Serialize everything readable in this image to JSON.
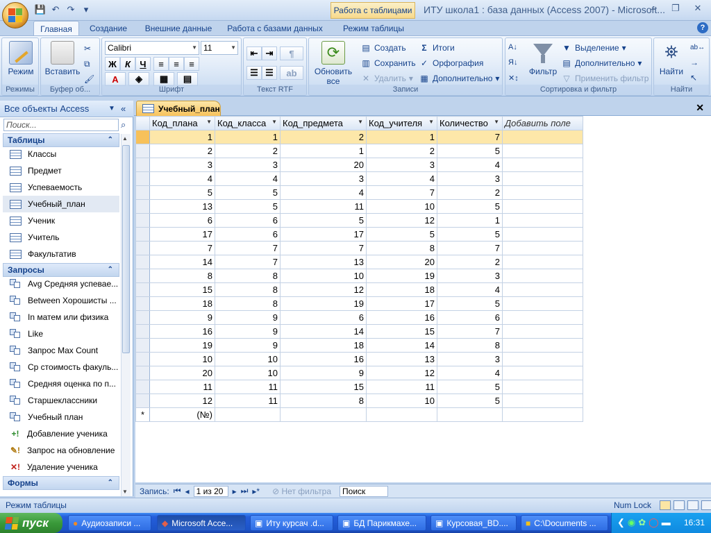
{
  "title_bar": {
    "context_tab": "Работа с таблицами",
    "window_title": "ИТУ школа1 : база данных (Access 2007) - Microsoft..."
  },
  "ribbon_tabs": [
    "Главная",
    "Создание",
    "Внешние данные",
    "Работа с базами данных",
    "Режим таблицы"
  ],
  "ribbon": {
    "groups": {
      "modes": "Режимы",
      "clipboard": "Буфер об...",
      "font": "Шрифт",
      "rtf": "Текст RTF",
      "records": "Записи",
      "sort_filter": "Сортировка и фильтр",
      "find": "Найти"
    },
    "view_label": "Режим",
    "paste_label": "Вставить",
    "font_name": "Calibri",
    "font_size": "11",
    "bold": "Ж",
    "italic": "К",
    "underline": "Ч",
    "refresh_label_1": "Обновить",
    "refresh_label_2": "все",
    "create": "Создать",
    "save": "Сохранить",
    "delete": "Удалить",
    "totals": "Итоги",
    "spelling": "Орфография",
    "more": "Дополнительно",
    "filter": "Фильтр",
    "selection": "Выделение",
    "advanced": "Дополнительно",
    "apply_filter": "Применить фильтр",
    "find": "Найти"
  },
  "nav_pane": {
    "header": "Все объекты Access",
    "search_placeholder": "Поиск...",
    "sections": [
      {
        "title": "Таблицы",
        "items": [
          "Классы",
          "Предмет",
          "Успеваемость",
          "Учебный_план",
          "Ученик",
          "Учитель",
          "Факультатив"
        ]
      },
      {
        "title": "Запросы",
        "items": [
          "Avg Средняя успевае...",
          "Between Хорошисты ...",
          "In матем или физика",
          "Like",
          "Запрос Max Count",
          "Ср стоимость факуль...",
          "Средняя оценка по п...",
          "Старшеклассники",
          "Учебный план",
          "Добавление ученика",
          "Запрос на обновление",
          "Удаление ученика"
        ]
      },
      {
        "title": "Формы",
        "items": []
      }
    ],
    "selected_item": "Учебный_план"
  },
  "document_tab": "Учебный_план",
  "table": {
    "columns": [
      "Код_плана",
      "Код_класса",
      "Код_предмета",
      "Код_учителя",
      "Количество"
    ],
    "add_field": "Добавить поле",
    "rows": [
      [
        1,
        1,
        2,
        1,
        7
      ],
      [
        2,
        2,
        1,
        2,
        5
      ],
      [
        3,
        3,
        20,
        3,
        4
      ],
      [
        4,
        4,
        3,
        4,
        3
      ],
      [
        5,
        5,
        4,
        7,
        2
      ],
      [
        13,
        5,
        11,
        10,
        5
      ],
      [
        6,
        6,
        5,
        12,
        1
      ],
      [
        17,
        6,
        17,
        5,
        5
      ],
      [
        7,
        7,
        7,
        8,
        7
      ],
      [
        14,
        7,
        13,
        20,
        2
      ],
      [
        8,
        8,
        10,
        19,
        3
      ],
      [
        15,
        8,
        12,
        18,
        4
      ],
      [
        18,
        8,
        19,
        17,
        5
      ],
      [
        9,
        9,
        6,
        16,
        6
      ],
      [
        16,
        9,
        14,
        15,
        7
      ],
      [
        19,
        9,
        18,
        14,
        8
      ],
      [
        10,
        10,
        16,
        13,
        3
      ],
      [
        20,
        10,
        9,
        12,
        4
      ],
      [
        11,
        11,
        15,
        11,
        5
      ],
      [
        12,
        11,
        8,
        10,
        5
      ]
    ],
    "new_row_placeholder": "(№)",
    "new_row_marker": "*"
  },
  "record_nav": {
    "label": "Запись:",
    "position": "1 из 20",
    "no_filter": "Нет фильтра",
    "search": "Поиск"
  },
  "status": {
    "mode": "Режим таблицы",
    "numlock": "Num Lock"
  },
  "taskbar": {
    "start": "пуск",
    "tasks": [
      "Аудиозаписи ...",
      "Microsoft Acce...",
      "Иту курсач .d...",
      "БД Парикмахе...",
      "Курсовая_BD....",
      "C:\\Documents ..."
    ],
    "clock": "16:31"
  }
}
